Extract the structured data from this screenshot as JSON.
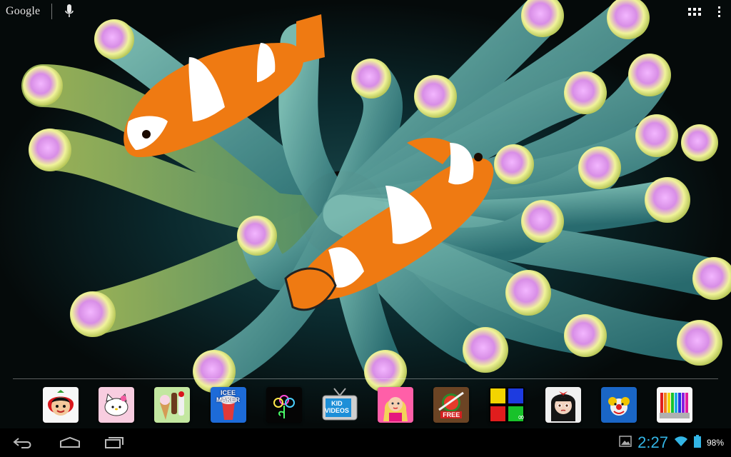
{
  "search": {
    "label": "Google"
  },
  "dock": {
    "apps": [
      {
        "name": "strawberry-girl-app"
      },
      {
        "name": "hello-kitty-app"
      },
      {
        "name": "ice-cream-app"
      },
      {
        "name": "icee-maker-app",
        "text": "ICEE MAKER"
      },
      {
        "name": "glow-draw-app"
      },
      {
        "name": "kid-videos-app",
        "text": "KID VIDEOS"
      },
      {
        "name": "dress-up-girl-app"
      },
      {
        "name": "fruit-ninja-free-app",
        "text": "FREE"
      },
      {
        "name": "color-blocks-app"
      },
      {
        "name": "emo-doll-app"
      },
      {
        "name": "clown-app"
      },
      {
        "name": "colored-pencils-app"
      }
    ]
  },
  "status": {
    "time": "2:27",
    "battery": "98%"
  },
  "colors": {
    "clock": "#33b5e5",
    "background": "#000000"
  },
  "icons": [
    "back-icon",
    "home-icon",
    "recent-apps-icon",
    "gallery-notification-icon",
    "wifi-icon",
    "battery-icon",
    "mic-icon",
    "apps-grid-icon",
    "overflow-menu-icon"
  ]
}
